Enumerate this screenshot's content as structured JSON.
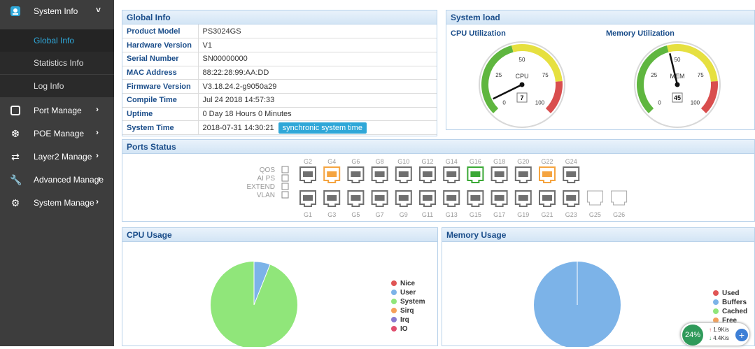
{
  "sidebar": {
    "items": [
      {
        "label": "System Info",
        "icon": "system-info-icon"
      },
      {
        "label": "Port Manage",
        "icon": "port-icon"
      },
      {
        "label": "POE Manage",
        "icon": "poe-icon"
      },
      {
        "label": "Layer2 Manage",
        "icon": "layer2-icon"
      },
      {
        "label": "Advanced Manage",
        "icon": "wrench-icon"
      },
      {
        "label": "System Manage",
        "icon": "gear-icon"
      }
    ],
    "sub": [
      {
        "label": "Global Info"
      },
      {
        "label": "Statistics Info"
      },
      {
        "label": "Log Info"
      }
    ]
  },
  "global_info": {
    "title": "Global Info",
    "rows": [
      {
        "k": "Product Model",
        "v": "PS3024GS"
      },
      {
        "k": "Hardware Version",
        "v": "V1"
      },
      {
        "k": "Serial Number",
        "v": "SN00000000"
      },
      {
        "k": "MAC Address",
        "v": "88:22:28:99:AA:DD"
      },
      {
        "k": "Firmware Version",
        "v": "V3.18.24.2-g9050a29"
      },
      {
        "k": "Compile Time",
        "v": "Jul 24 2018 14:57:33"
      },
      {
        "k": "Uptime",
        "v": "0 Day 18 Hours 0 Minutes"
      },
      {
        "k": "System Time",
        "v": "2018-07-31 14:30:21"
      }
    ],
    "sync_label": "synchronic system time"
  },
  "system_load": {
    "title": "System load",
    "cpu": {
      "title": "CPU Utilization",
      "center": "CPU",
      "value": 7,
      "t0": "0",
      "t25": "25",
      "t50": "50",
      "t75": "75",
      "t100": "100"
    },
    "mem": {
      "title": "Memory Utilization",
      "center": "MEM",
      "value": 45,
      "t0": "0",
      "t25": "25",
      "t50": "50",
      "t75": "75",
      "t100": "100"
    }
  },
  "ports": {
    "title": "Ports Status",
    "legend": [
      "QOS",
      "AI PS",
      "EXTEND",
      "VLAN"
    ],
    "top": [
      "G2",
      "G4",
      "G6",
      "G8",
      "G10",
      "G12",
      "G14",
      "G16",
      "G18",
      "G20",
      "G22",
      "G24"
    ],
    "bottom": [
      "G1",
      "G3",
      "G5",
      "G7",
      "G9",
      "G11",
      "G13",
      "G15",
      "G17",
      "G19",
      "G21",
      "G23",
      "G25",
      "G26"
    ],
    "top_state": [
      "off",
      "orange",
      "off",
      "off",
      "off",
      "off",
      "off",
      "green",
      "off",
      "off",
      "orange",
      "off"
    ],
    "colors": {
      "off": "#6f6f6f",
      "orange": "#f5a440",
      "green": "#3aa835"
    }
  },
  "cpu_usage": {
    "title": "CPU Usage",
    "legend": [
      {
        "label": "Nice",
        "color": "#e05555"
      },
      {
        "label": "User",
        "color": "#7cb3e8"
      },
      {
        "label": "System",
        "color": "#90e67a"
      },
      {
        "label": "Sirq",
        "color": "#f5a05a"
      },
      {
        "label": "Irq",
        "color": "#8879d0"
      },
      {
        "label": "IO",
        "color": "#e04e6e"
      }
    ]
  },
  "memory_usage": {
    "title": "Memory Usage",
    "legend": [
      {
        "label": "Used",
        "color": "#e05555"
      },
      {
        "label": "Buffers",
        "color": "#7cb3e8"
      },
      {
        "label": "Cached",
        "color": "#90e67a"
      },
      {
        "label": "Free",
        "color": "#f5a05a"
      }
    ]
  },
  "net_widget": {
    "percent": "24%",
    "up": "1.9K/s",
    "down": "4.4K/s"
  }
}
